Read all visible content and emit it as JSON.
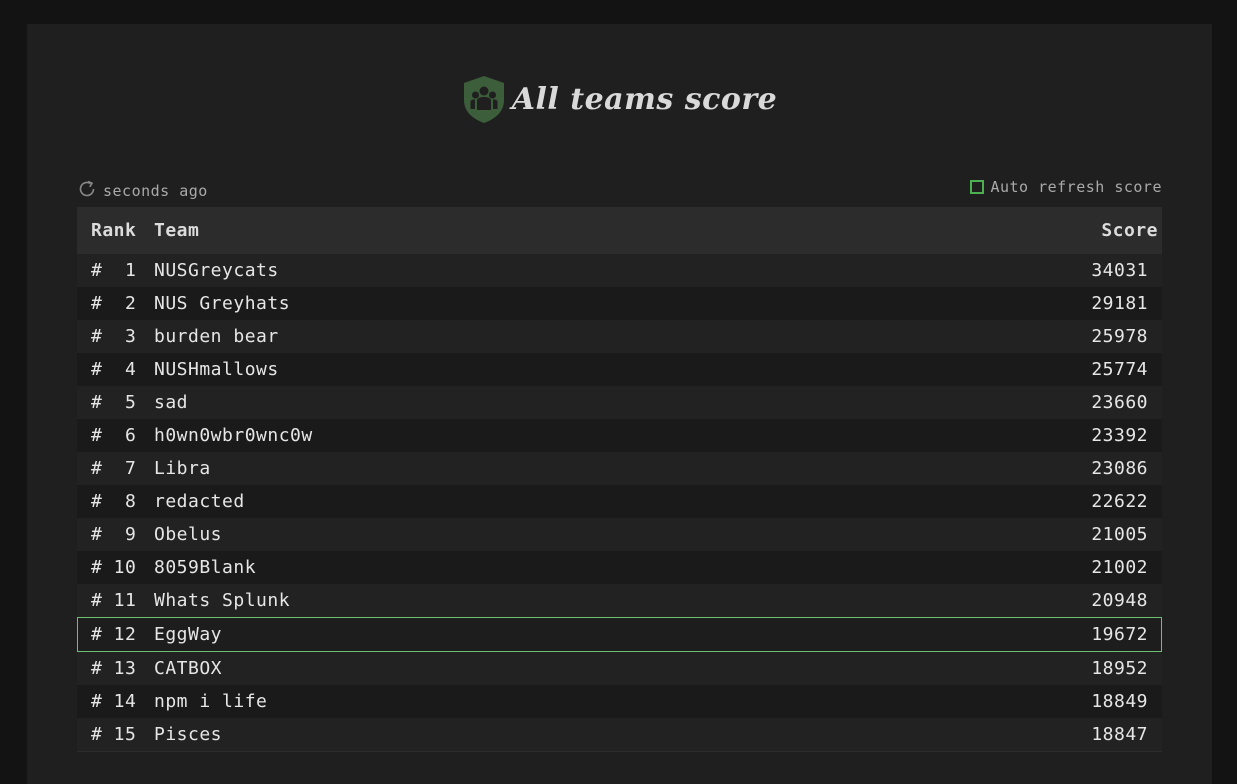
{
  "header": {
    "title": "All teams score",
    "icon": "team-shield-icon",
    "accent_color": "#3d5e3a"
  },
  "toolbar": {
    "last_updated": "seconds ago",
    "auto_refresh_label": "Auto refresh score",
    "auto_refresh_checked": false
  },
  "table": {
    "columns": [
      "Rank",
      "Team",
      "Score"
    ],
    "rows": [
      {
        "rank": "#  1",
        "team": "NUSGreycats",
        "score": "34031"
      },
      {
        "rank": "#  2",
        "team": "NUS Greyhats",
        "score": "29181"
      },
      {
        "rank": "#  3",
        "team": "burden bear",
        "score": "25978"
      },
      {
        "rank": "#  4",
        "team": "NUSHmallows",
        "score": "25774"
      },
      {
        "rank": "#  5",
        "team": "sad",
        "score": "23660"
      },
      {
        "rank": "#  6",
        "team": "h0wn0wbr0wnc0w",
        "score": "23392"
      },
      {
        "rank": "#  7",
        "team": "Libra",
        "score": "23086"
      },
      {
        "rank": "#  8",
        "team": "redacted",
        "score": "22622"
      },
      {
        "rank": "#  9",
        "team": "Obelus",
        "score": "21005"
      },
      {
        "rank": "# 10",
        "team": "8059Blank",
        "score": "21002"
      },
      {
        "rank": "# 11",
        "team": "Whats Splunk",
        "score": "20948"
      },
      {
        "rank": "# 12",
        "team": "EggWay",
        "score": "19672"
      },
      {
        "rank": "# 13",
        "team": "CATBOX",
        "score": "18952"
      },
      {
        "rank": "# 14",
        "team": "npm i life",
        "score": "18849"
      },
      {
        "rank": "# 15",
        "team": "Pisces",
        "score": "18847"
      }
    ],
    "highlight_color": "#6fbf73"
  }
}
